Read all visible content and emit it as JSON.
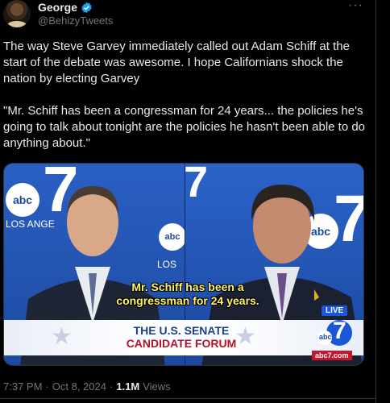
{
  "author": {
    "display_name": "George",
    "handle": "@BehizyTweets",
    "verified": true,
    "verified_color": "#1d9bf0"
  },
  "tweet": {
    "text": "The way Steve Garvey immediately called out Adam Schiff at the start of the debate was awesome. I hope Californians shock the nation by electing Garvey\n\n\"Mr. Schiff has been a congressman for 24 years... the policies he's going to talk about tonight are the policies he hasn't been able to do anything about.\""
  },
  "media": {
    "left_logo_text": "abc",
    "left_seven": "7",
    "left_city": "LOS ANGE",
    "mid_logo_text": "abc",
    "mid_los": "LOS",
    "right_logo_text": "abc",
    "right_seven": "7",
    "caption_line1": "Mr. Schiff has been a",
    "caption_line2": "congressman for 24 years.",
    "banner_line1": "THE U.S. SENATE",
    "banner_line2": "CANDIDATE FORUM",
    "live_label": "LIVE",
    "corner_logo_text": "abc",
    "corner_seven": "7",
    "site_label": "abc7.com",
    "accent_blue": "#1d4aa0",
    "caption_yellow": "#fff36b",
    "banner_red": "#b0132b"
  },
  "meta": {
    "time": "7:37 PM",
    "separator": "·",
    "date": "Oct 8, 2024",
    "separator2": "·",
    "views_count": "1.1M",
    "views_label": "Views"
  },
  "icons": {
    "more": "more-icon",
    "verified": "verified-badge-icon"
  }
}
